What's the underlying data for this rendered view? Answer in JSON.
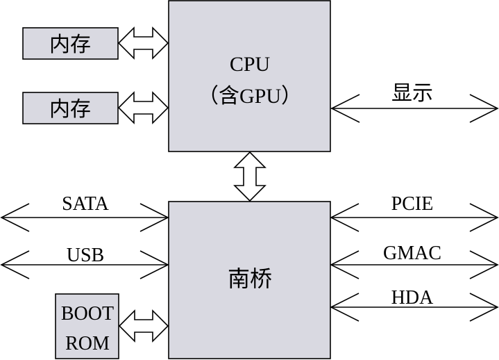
{
  "blocks": {
    "memory_1": "内存",
    "memory_2": "内存",
    "cpu_line1": "CPU",
    "cpu_line2": "（含GPU）",
    "southbridge": "南桥",
    "boot_rom_line1": "BOOT",
    "boot_rom_line2": "ROM"
  },
  "interfaces": {
    "display": "显示",
    "sata": "SATA",
    "usb": "USB",
    "pcie": "PCIE",
    "gmac": "GMAC",
    "hda": "HDA"
  }
}
